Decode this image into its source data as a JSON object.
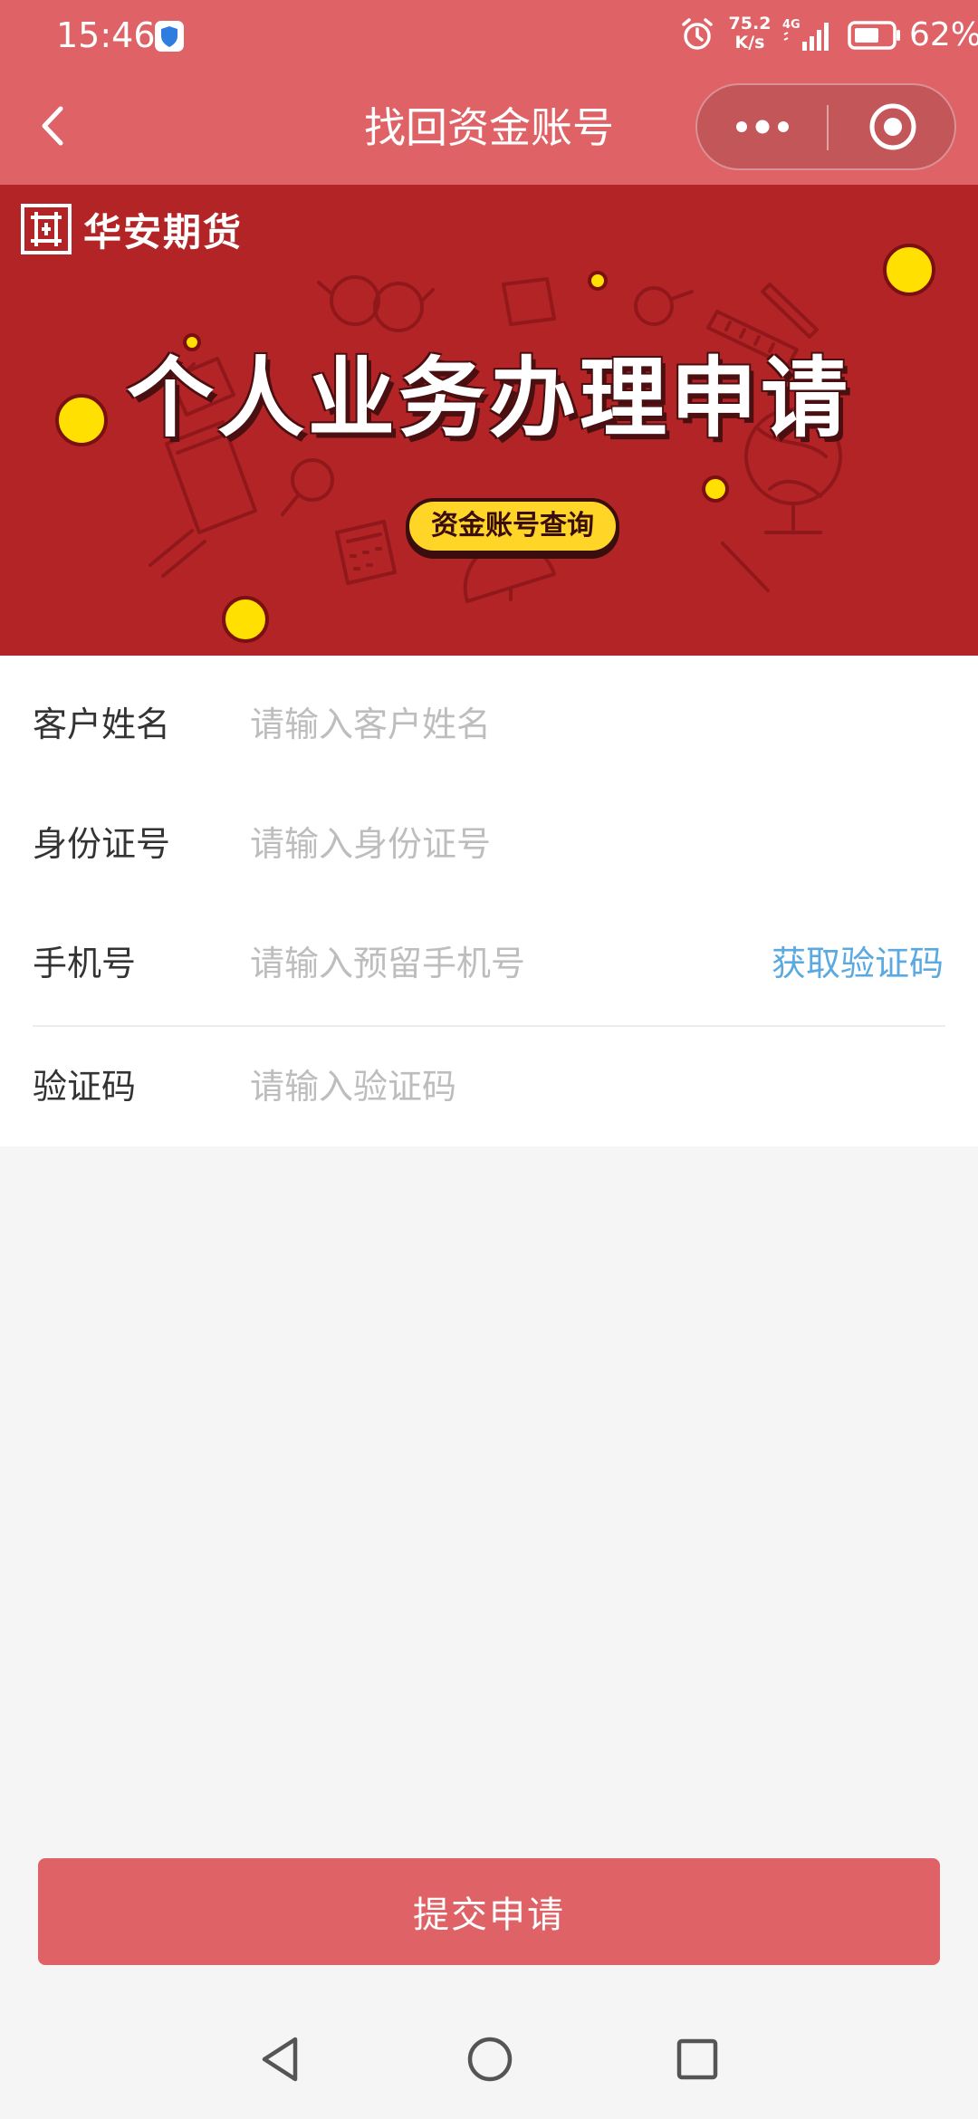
{
  "status_bar": {
    "time": "15:46",
    "net_speed_value": "75.2",
    "net_speed_unit": "K/s",
    "network_type": "4G",
    "battery": "62%"
  },
  "nav": {
    "title": "找回资金账号",
    "back_icon": "chevron-left-icon",
    "more_icon": "more-dots-icon",
    "close_icon": "target-close-icon"
  },
  "banner": {
    "brand_name": "华安期货",
    "headline": "个人业务办理申请",
    "pill_text": "资金账号查询"
  },
  "form": {
    "rows": [
      {
        "label": "客户姓名",
        "placeholder": "请输入客户姓名",
        "value": ""
      },
      {
        "label": "身份证号",
        "placeholder": "请输入身份证号",
        "value": ""
      },
      {
        "label": "手机号",
        "placeholder": "请输入预留手机号",
        "value": ""
      },
      {
        "label": "验证码",
        "placeholder": "请输入验证码",
        "value": ""
      }
    ],
    "get_code_label": "获取验证码"
  },
  "submit_label": "提交申请",
  "colors": {
    "header": "#df6266",
    "banner": "#b32427",
    "accent_link": "#5aa9e0",
    "button": "#df6266"
  }
}
